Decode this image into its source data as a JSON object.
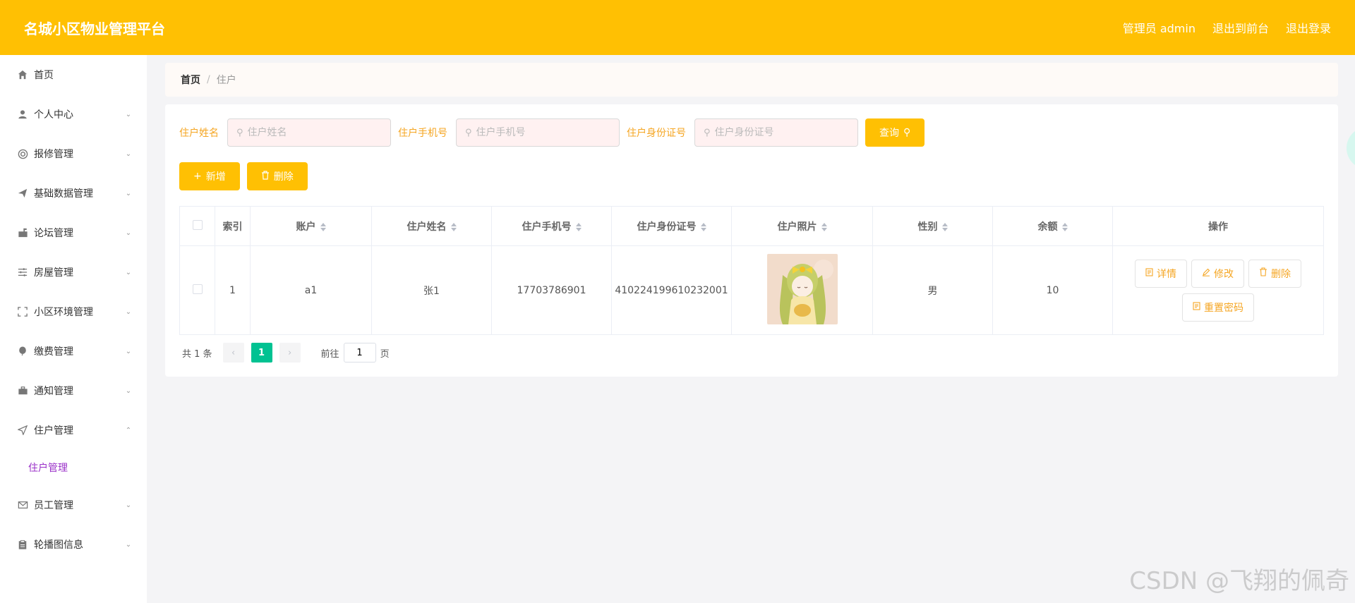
{
  "header": {
    "title": "名城小区物业管理平台",
    "admin_label": "管理员 admin",
    "to_front_label": "退出到前台",
    "logout_label": "退出登录"
  },
  "sidebar": {
    "items": [
      {
        "label": "首页",
        "icon": "home-icon",
        "expandable": false
      },
      {
        "label": "个人中心",
        "icon": "user-icon",
        "expandable": true
      },
      {
        "label": "报修管理",
        "icon": "lifebuoy-icon",
        "expandable": true
      },
      {
        "label": "基础数据管理",
        "icon": "send-icon",
        "expandable": true
      },
      {
        "label": "论坛管理",
        "icon": "mailbox-icon",
        "expandable": true
      },
      {
        "label": "房屋管理",
        "icon": "sliders-icon",
        "expandable": true
      },
      {
        "label": "小区环境管理",
        "icon": "frame-icon",
        "expandable": true
      },
      {
        "label": "缴费管理",
        "icon": "balloon-icon",
        "expandable": true
      },
      {
        "label": "通知管理",
        "icon": "briefcase-icon",
        "expandable": true
      },
      {
        "label": "住户管理",
        "icon": "navigation-icon",
        "expandable": true,
        "open": true
      },
      {
        "label": "员工管理",
        "icon": "mail-icon",
        "expandable": true
      },
      {
        "label": "轮播图信息",
        "icon": "clipboard-icon",
        "expandable": true
      }
    ],
    "submenu_active": "住户管理"
  },
  "breadcrumb": {
    "home": "首页",
    "separator": "/",
    "current": "住户"
  },
  "search": {
    "name_label": "住户姓名",
    "name_placeholder": "住户姓名",
    "phone_label": "住户手机号",
    "phone_placeholder": "住户手机号",
    "id_label": "住户身份证号",
    "id_placeholder": "住户身份证号",
    "query_label": "查询"
  },
  "actions": {
    "add_label": "新增",
    "delete_label": "删除"
  },
  "table": {
    "columns": [
      "索引",
      "账户",
      "住户姓名",
      "住户手机号",
      "住户身份证号",
      "住户照片",
      "性别",
      "余额",
      "操作"
    ],
    "rows": [
      {
        "index": "1",
        "account": "a1",
        "name": "张1",
        "phone": "17703786901",
        "id_number": "410224199610232001",
        "gender": "男",
        "balance": "10",
        "ops": [
          "详情",
          "修改",
          "删除",
          "重置密码"
        ]
      }
    ]
  },
  "pagination": {
    "total_text": "共 1 条",
    "current_page": "1",
    "goto_label": "前往",
    "goto_value": "1",
    "page_suffix": "页"
  },
  "watermark": "CSDN @飞翔的佩奇",
  "colors": {
    "primary": "#ffc003",
    "accent_text": "#f5a623",
    "pager_active": "#00c292",
    "submenu_active": "#9a31c8"
  }
}
